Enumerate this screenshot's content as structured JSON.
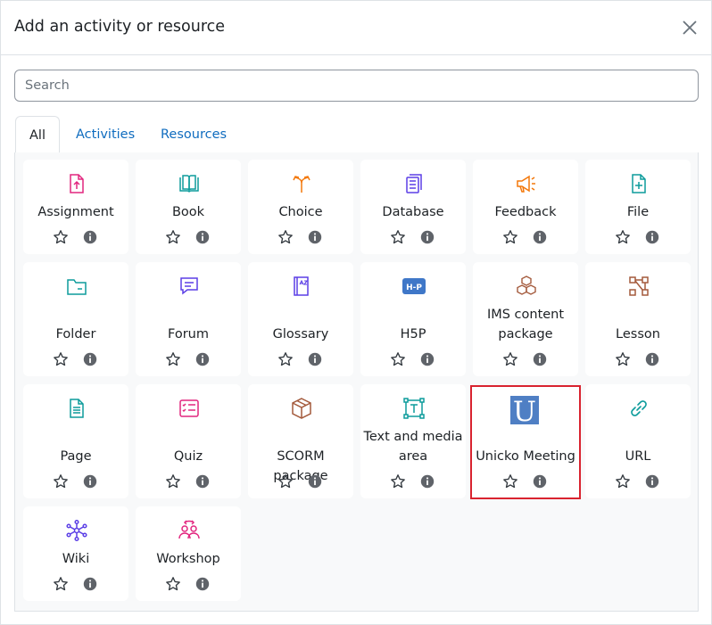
{
  "modal": {
    "title": "Add an activity or resource"
  },
  "search": {
    "placeholder": "Search"
  },
  "tabs": [
    {
      "label": "All",
      "active": true
    },
    {
      "label": "Activities",
      "active": false
    },
    {
      "label": "Resources",
      "active": false
    }
  ],
  "items": [
    {
      "label": "Assignment",
      "icon": "assignment-icon",
      "color": "#e2267f"
    },
    {
      "label": "Book",
      "icon": "book-icon",
      "color": "#0d9c9c"
    },
    {
      "label": "Choice",
      "icon": "choice-icon",
      "color": "#f3780b"
    },
    {
      "label": "Database",
      "icon": "database-icon",
      "color": "#5b3fe6"
    },
    {
      "label": "Feedback",
      "icon": "feedback-icon",
      "color": "#f3780b"
    },
    {
      "label": "File",
      "icon": "file-icon",
      "color": "#0d9c9c"
    },
    {
      "label": "Folder",
      "icon": "folder-icon",
      "color": "#0d9c9c"
    },
    {
      "label": "Forum",
      "icon": "forum-icon",
      "color": "#5b3fe6"
    },
    {
      "label": "Glossary",
      "icon": "glossary-icon",
      "color": "#5b3fe6"
    },
    {
      "label": "H5P",
      "icon": "h5p-icon",
      "color": "#3f77c8"
    },
    {
      "label": "IMS content package",
      "icon": "ims-package-icon",
      "color": "#a45a3c"
    },
    {
      "label": "Lesson",
      "icon": "lesson-icon",
      "color": "#a45a3c"
    },
    {
      "label": "Page",
      "icon": "page-icon",
      "color": "#0d9c9c"
    },
    {
      "label": "Quiz",
      "icon": "quiz-icon",
      "color": "#e2267f"
    },
    {
      "label": "SCORM package",
      "icon": "scorm-icon",
      "color": "#a45a3c"
    },
    {
      "label": "Text and media area",
      "icon": "text-media-icon",
      "color": "#0d9c9c"
    },
    {
      "label": "Unicko Meeting",
      "icon": "unicko-icon",
      "color": "#4f7fc4"
    },
    {
      "label": "URL",
      "icon": "url-icon",
      "color": "#0d9c9c"
    },
    {
      "label": "Wiki",
      "icon": "wiki-icon",
      "color": "#5b3fe6"
    },
    {
      "label": "Workshop",
      "icon": "workshop-icon",
      "color": "#e2267f"
    }
  ],
  "unicko_logo_letter": "U",
  "h5p_logo_text": "H-P"
}
